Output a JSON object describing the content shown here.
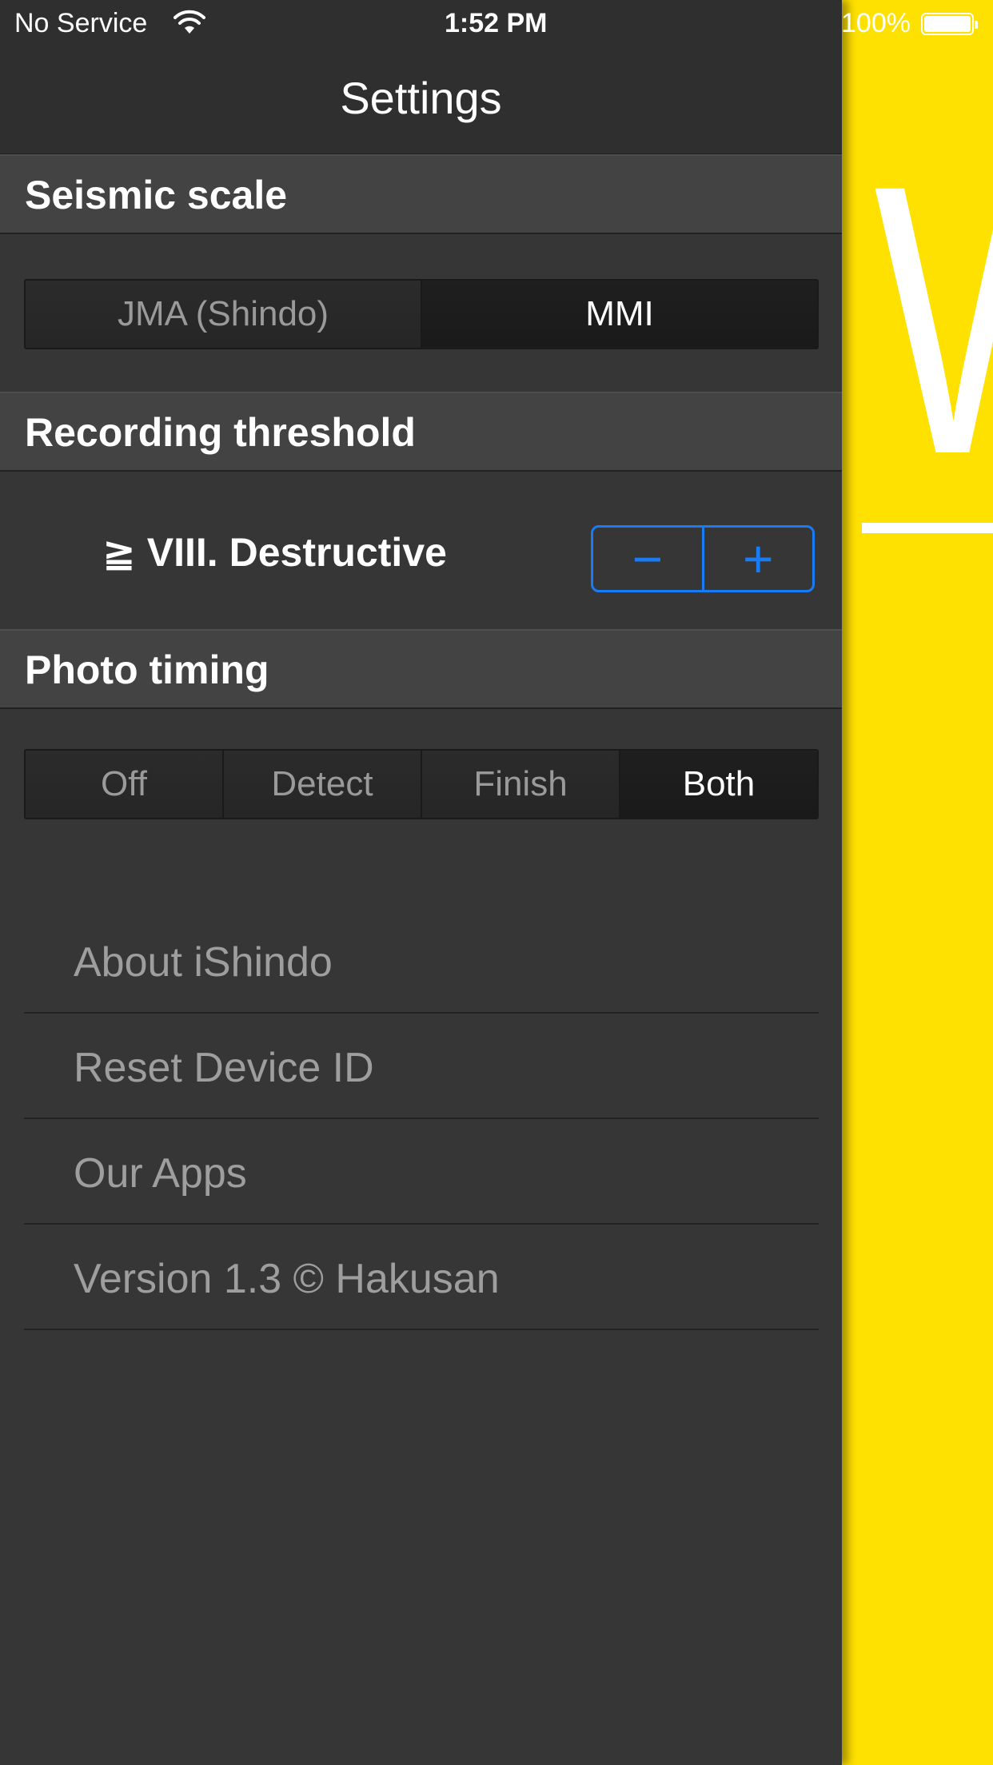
{
  "status_bar": {
    "carrier": "No Service",
    "time": "1:52 PM",
    "battery_percent": "100%"
  },
  "nav": {
    "title": "Settings"
  },
  "sections": {
    "seismic_scale": {
      "header": "Seismic scale",
      "options": [
        "JMA (Shindo)",
        "MMI"
      ],
      "selected": "MMI"
    },
    "recording_threshold": {
      "header": "Recording threshold",
      "value": "≧ VIII. Destructive",
      "minus_label": "−",
      "plus_label": "+"
    },
    "photo_timing": {
      "header": "Photo timing",
      "options": [
        "Off",
        "Detect",
        "Finish",
        "Both"
      ],
      "selected": "Both"
    }
  },
  "menu": {
    "items": [
      "About iShindo",
      "Reset Device ID",
      "Our Apps",
      "Version 1.3  © Hakusan"
    ]
  },
  "right_panel": {
    "letter": "W"
  },
  "colors": {
    "accent": "#1A7CF5",
    "panel_yellow": "#FFE100",
    "background": "#363636"
  }
}
